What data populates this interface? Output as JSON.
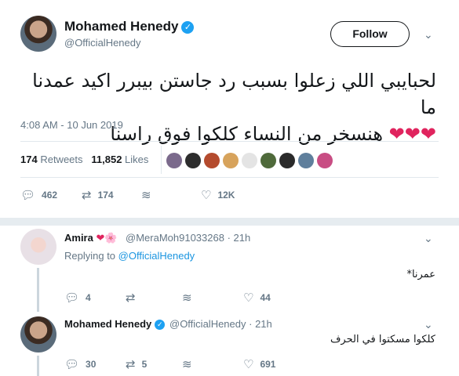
{
  "tweet": {
    "author": {
      "name": "Mohamed Henedy",
      "handle": "@OfficialHenedy",
      "verified": true
    },
    "follow_label": "Follow",
    "text_line1": "لحبايبي اللي زعلوا بسبب رد جاستن بيبرر اكيد عمدنا ما",
    "text_line2": "هنسخر من النساء كلكوا فوق راسنا",
    "hearts": "❤❤❤",
    "timestamp": "4:08 AM - 10 Jun 2019",
    "stats": {
      "retweets": "174",
      "retweets_label": "Retweets",
      "likes": "11,852",
      "likes_label": "Likes"
    },
    "liker_colors": [
      "#7b6a8c",
      "#2d2d2d",
      "#b44b2e",
      "#d7a35c",
      "#e4e4e4",
      "#4f6a3b",
      "#2a2a2a",
      "#5f7f9c",
      "#c84d83"
    ],
    "actions": {
      "replies": "462",
      "retweets": "174",
      "likes": "12K"
    }
  },
  "replies": [
    {
      "name": "Amira",
      "emoji": "❤🌸",
      "handle": "@MeraMoh91033268",
      "time": "· 21h",
      "replying_prefix": "Replying to",
      "replying_to": "@OfficialHenedy",
      "text": "عمرنا*",
      "actions": {
        "replies": "4",
        "retweets": "",
        "likes": "44"
      }
    },
    {
      "name": "Mohamed Henedy",
      "handle": "@OfficialHenedy",
      "time": "· 21h",
      "text": "كلكوا مسكتوا في الحرف",
      "actions": {
        "replies": "30",
        "retweets": "5",
        "likes": "691"
      }
    }
  ],
  "icons": {
    "reply": "reply-icon",
    "retweet": "retweet-icon",
    "share": "share-icon",
    "like": "heart-icon",
    "more": "chevron-down-icon",
    "verified": "verified-badge-icon"
  }
}
